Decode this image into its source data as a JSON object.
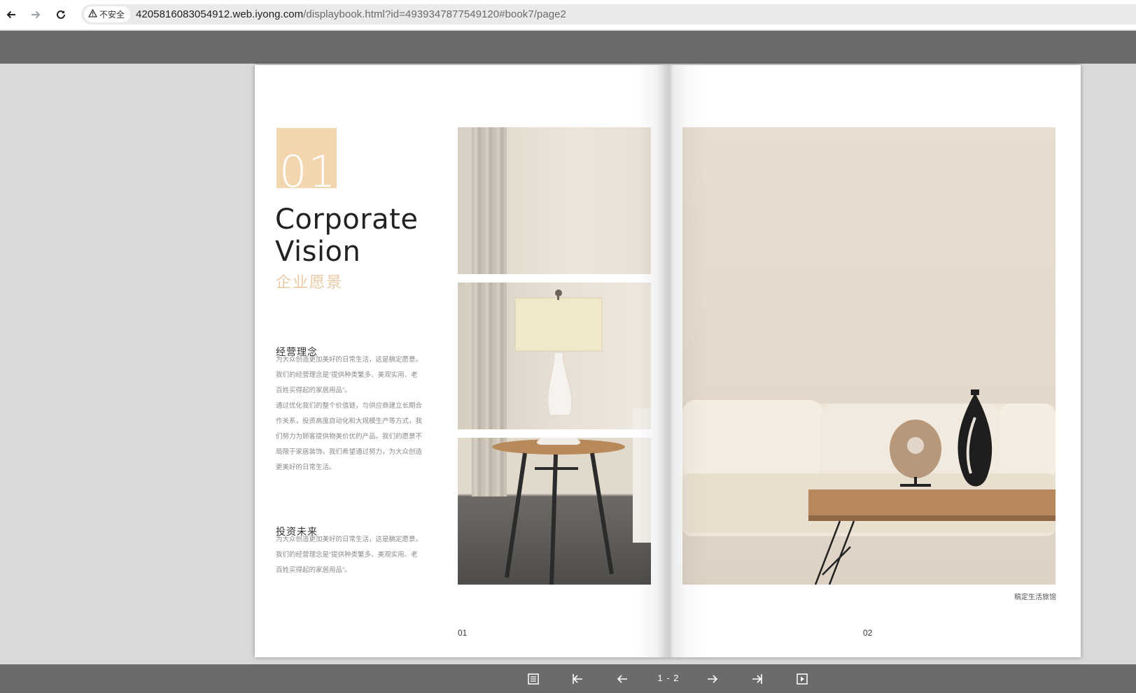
{
  "browser": {
    "security_label": "不安全",
    "url_domain": "4205816083054912.web.iyong.com",
    "url_path": "/displaybook.html?id=4939347877549120#book7/page2"
  },
  "left_page": {
    "number_badge": "01",
    "title_line1": "Corporate",
    "title_line2": "Vision",
    "title_cn": "企业愿景",
    "section1": {
      "heading": "经营理念",
      "lines": [
        "为大众创造更加美好的日常生活，这是稿定愿景。",
        "我们的经营理念是“提供种类繁多、美观实用、老",
        "百姓买得起的家居用品”。",
        "通过优化我们的整个价值链，与供应商建立长期合",
        "作关系，投资高度自动化和大规模生产等方式，我",
        "们努力为顾客提供物美价优的产品。我们的愿景不",
        "局限于家居装饰。我们希望通过努力，为大众创造",
        "更美好的日常生活。"
      ]
    },
    "section2": {
      "heading": "投资未来",
      "lines": [
        "为大众创造更加美好的日常生活，这是稿定愿景。",
        "我们的经营理念是“提供种类繁多、美观实用、老",
        "百姓买得起的家居用品”。"
      ]
    },
    "page_number": "01"
  },
  "right_page": {
    "brand": "稿定生活旅馆",
    "page_number": "02"
  },
  "toolbar": {
    "page_indicator": "1 - 2"
  },
  "colors": {
    "accent": "#f3d5ae",
    "accent_text": "#e7c9a3",
    "toolbar": "#6b6b6b"
  }
}
